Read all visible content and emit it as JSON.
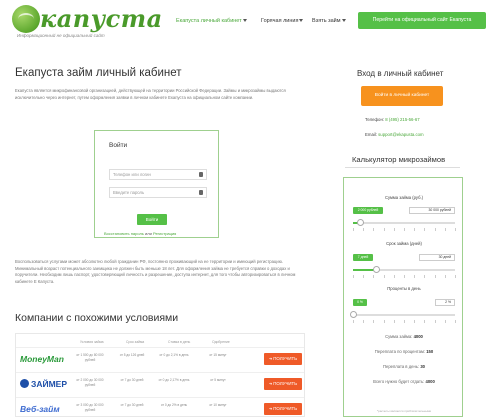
{
  "header": {
    "logo_text": "капуста",
    "logo_subtitle": "Информационный не официальный сайт",
    "nav": [
      {
        "label": "Екапуста личный кабинет"
      },
      {
        "label": "Горячая линия"
      },
      {
        "label": "Взять займ"
      }
    ],
    "cta_label": "Перейти на официальный сайт Екапуста"
  },
  "main": {
    "title": "Екапуста займ личный кабинет",
    "intro": "Екапуста является микрофинансовой организацией, действующей на территории Российской Федерации. Займы и микрозаймы выдаются исключительно через интернет, путем оформления заявки в личном кабинете Екапуста на официальном сайте компании.",
    "login": {
      "title": "Войти",
      "phone_placeholder": "Телефон или логин",
      "password_placeholder": "Введите пароль",
      "submit": "Войти",
      "forgot": "Восстановить пароль",
      "or": "или",
      "register": "Регистрация"
    },
    "paragraph2": "Воспользоваться услугами может абсолютно любой гражданин РФ, постоянно проживающий на ее территории и имеющий регистрацию. Минимальный возраст потенциального заемщика не должен быть меньше 18 лет. Для оформления займа не требуется справки о доходах и поручители. Необходим лишь паспорт, удостоверяющий личность и разрешение, доступа интернет, для того чтобы авторизироваться в личном кабинете Е Капуста.",
    "similar_title": "Компании с похожими условиями",
    "table": {
      "headers": [
        "Условия займа",
        "Срок займа",
        "Ставка в день",
        "Одобрение"
      ],
      "rows": [
        {
          "brand": "MoneyMan",
          "amount": "от 1 500 до 80 000 рублей",
          "term": "от 5 до 126 дней",
          "rate": "от 0 до 2,1% в день",
          "approval": "от 15 минут",
          "button": "ПОЛУЧИТЬ"
        },
        {
          "brand": "ЗАЙМЕР",
          "amount": "от 2 000 до 30 000 рублей",
          "term": "от 7 до 30 дней",
          "rate": "от 0 до 2,17% в день",
          "approval": "от 5 минут",
          "button": "ПОЛУЧИТЬ"
        },
        {
          "brand": "Веб-займ",
          "amount": "от 3 000 до 30 000 рублей",
          "term": "от 7 до 30 дней",
          "rate": "от 0 до 2% в день",
          "approval": "от 10 минут",
          "button": "ПОЛУЧИТЬ"
        }
      ]
    }
  },
  "sidebar": {
    "login_title": "Вход в личный кабинет",
    "login_button": "Войти в личный кабинет",
    "phone_label": "Телефон:",
    "phone_value": "8 (495) 215-56-67",
    "email_label": "Email:",
    "email_value": "support@ekapusta.com",
    "calc_title": "Калькулятор микрозаймов",
    "calc": {
      "sum_label": "Сумма займа (руб.)",
      "sum_green": "2 000 рублей",
      "sum_value": "30 000 рублей",
      "sum_fraction": 0.07,
      "term_label": "Срок займа (дней)",
      "term_green": "7 дней",
      "term_value": "30 дней",
      "term_fraction": 0.23,
      "rate_label": "Проценты в день",
      "rate_green": "0 %",
      "rate_value": "2 %",
      "rate_fraction": 0.0,
      "result_sum_label": "Сумма займа:",
      "result_sum_value": "4000",
      "result_interest_label": "Переплата по процентам:",
      "result_interest_value": "150",
      "result_days_label": "Переплата в день:",
      "result_days_value": "30",
      "result_total_label": "Всего нужно будет отдать:",
      "result_total_value": "4000",
      "note": "*расчеты являются приблизительными"
    }
  },
  "colors": {
    "brand_green": "#55c047",
    "accent_orange": "#f7921e",
    "button_red": "#ef5a28"
  }
}
